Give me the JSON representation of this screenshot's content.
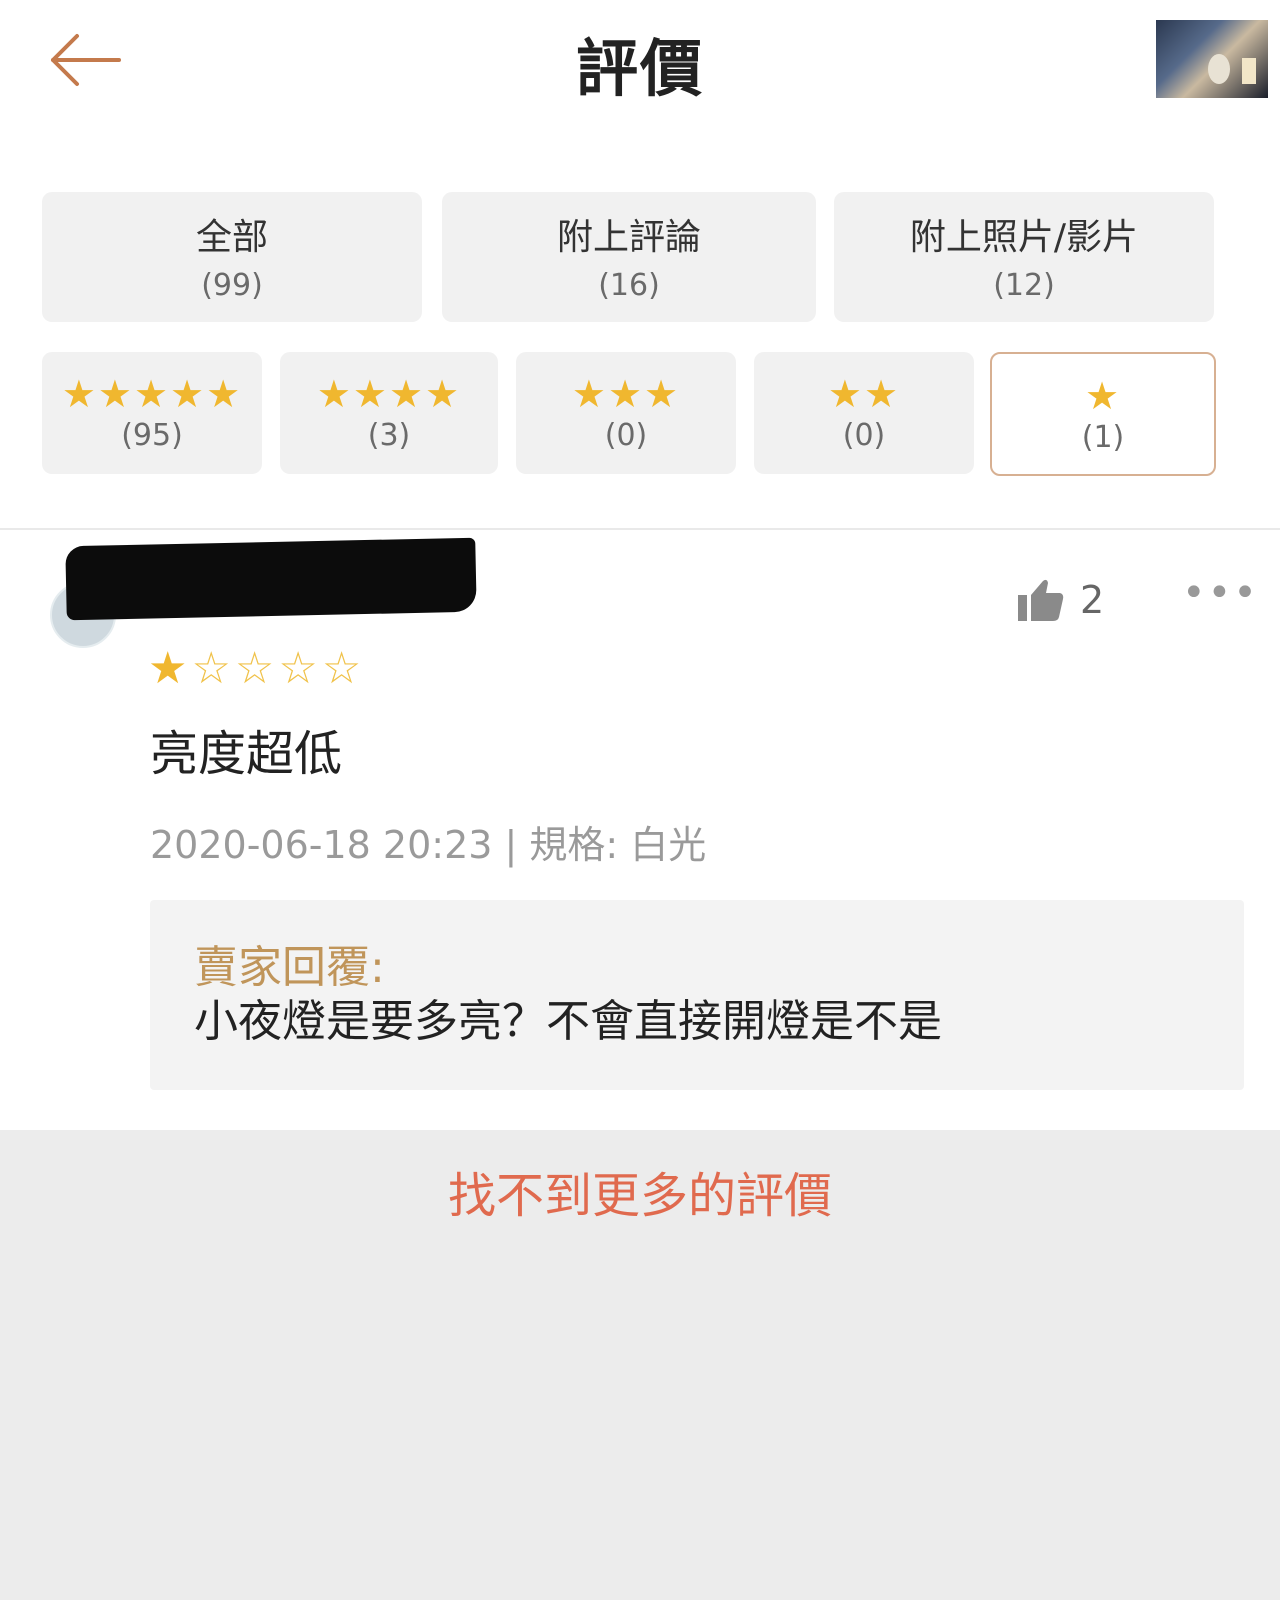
{
  "header": {
    "title": "評價",
    "back_icon": "arrow-left-icon",
    "product_thumb": "product-thumbnail"
  },
  "filters": {
    "top": [
      {
        "label": "全部",
        "count": "(99)"
      },
      {
        "label": "附上評論",
        "count": "(16)"
      },
      {
        "label": "附上照片/影片",
        "count": "(12)"
      }
    ],
    "stars": [
      {
        "stars": "★★★★★",
        "count": "(95)",
        "selected": false
      },
      {
        "stars": "★★★★",
        "count": "(3)",
        "selected": false
      },
      {
        "stars": "★★★",
        "count": "(0)",
        "selected": false
      },
      {
        "stars": "★★",
        "count": "(0)",
        "selected": false
      },
      {
        "stars": "★",
        "count": "(1)",
        "selected": true
      }
    ]
  },
  "review": {
    "rating": 1,
    "rating_max": 5,
    "likes": "2",
    "more": "•••",
    "text": "亮度超低",
    "meta": "2020-06-18 20:23 | 規格: 白光",
    "seller_reply_label": "賣家回覆:",
    "seller_reply_text": "小夜燈是要多亮？不會直接開燈是不是"
  },
  "footer": {
    "no_more": "找不到更多的評價"
  },
  "colors": {
    "accent": "#e06a4e",
    "star": "#f0b72f",
    "selected_border": "#d7b092",
    "reply_label": "#c0955a"
  }
}
